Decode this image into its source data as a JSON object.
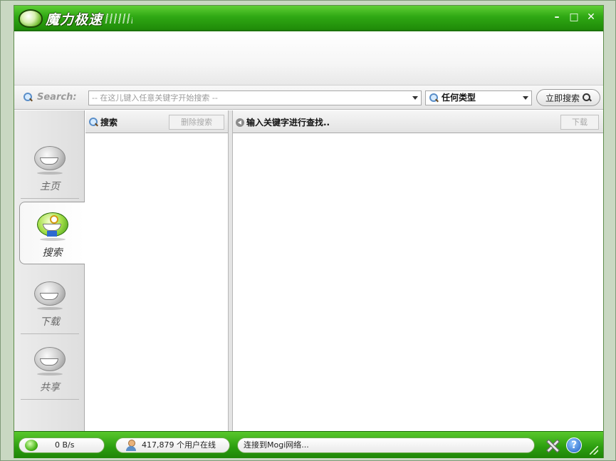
{
  "window": {
    "title": "魔力极速",
    "controls": {
      "minimize": "–",
      "maximize": "□",
      "close": "✕"
    }
  },
  "search": {
    "label": "Search:",
    "placeholder": "-- 在这儿键入任意关键字开始搜索 --",
    "type_selected": "任何类型",
    "go_label": "立即搜索"
  },
  "sidebar": {
    "items": [
      {
        "label": "主页",
        "icon": "home-mascot-icon",
        "active": false
      },
      {
        "label": "搜索",
        "icon": "search-mascot-icon",
        "active": true
      },
      {
        "label": "下载",
        "icon": "download-mascot-icon",
        "active": false
      },
      {
        "label": "共享",
        "icon": "share-mascot-icon",
        "active": false
      }
    ]
  },
  "left_panel": {
    "title": "搜索",
    "clear_button": "删除搜索"
  },
  "right_panel": {
    "title": "输入关键字进行查找..",
    "download_button": "下载"
  },
  "status": {
    "speed": "0 B/s",
    "users_online": "417,879 个用户在线",
    "connection": "连接到Mogi网络..."
  },
  "colors": {
    "accent_green": "#2fa814",
    "accent_dark_green": "#1b7306"
  }
}
